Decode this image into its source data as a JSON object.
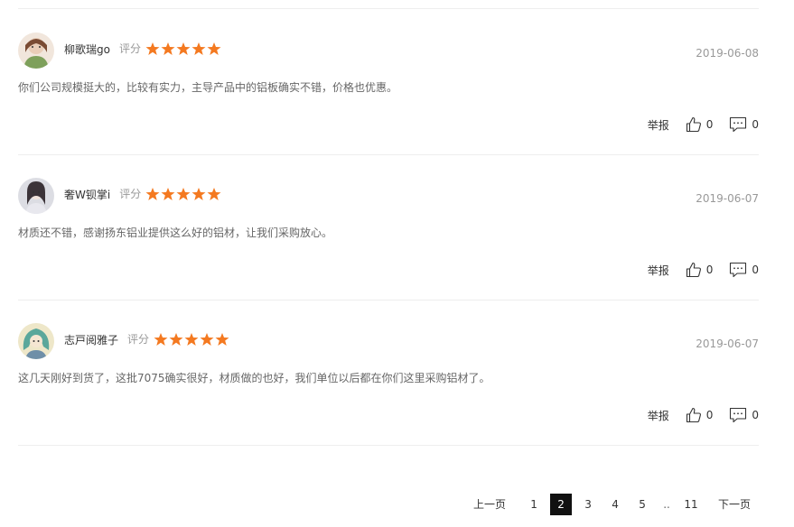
{
  "reviews": [
    {
      "username": "柳歌瑞go",
      "rating_label": "评分",
      "rating": 5,
      "date": "2019-06-08",
      "content": "你们公司规模挺大的，比较有实力，主导产品中的铝板确实不错，价格也优惠。",
      "report_label": "举报",
      "likes": "0",
      "comments": "0"
    },
    {
      "username": "奢W钡掌i",
      "rating_label": "评分",
      "rating": 5,
      "date": "2019-06-07",
      "content": "材质还不错，感谢扬东铝业提供这么好的铝材，让我们采购放心。",
      "report_label": "举报",
      "likes": "0",
      "comments": "0"
    },
    {
      "username": "志戸阅雅子",
      "rating_label": "评分",
      "rating": 5,
      "date": "2019-06-07",
      "content": "这几天刚好到货了，这批7075确实很好，材质做的也好，我们单位以后都在你们这里采购铝材了。",
      "report_label": "举报",
      "likes": "0",
      "comments": "0"
    }
  ],
  "pagination": {
    "prev_label": "上一页",
    "next_label": "下一页",
    "pages": [
      "1",
      "2",
      "3",
      "4",
      "5"
    ],
    "ellipsis": "..",
    "last_page": "11",
    "current": "2"
  },
  "colors": {
    "star": "#F47920",
    "active_page_bg": "#111111",
    "muted_text": "#999999"
  }
}
